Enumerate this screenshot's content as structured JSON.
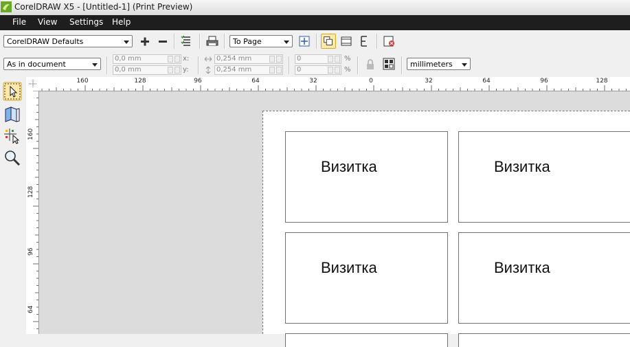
{
  "window": {
    "title": "CorelDRAW X5 - [Untitled-1] (Print Preview)"
  },
  "menu": [
    {
      "label": "File"
    },
    {
      "label": "View"
    },
    {
      "label": "Settings"
    },
    {
      "label": "Help"
    }
  ],
  "toolbar1": {
    "preset": "CorelDRAW Defaults",
    "fit": "To Page"
  },
  "toolbar2": {
    "position_mode": "As in document",
    "x_value": "0,0 mm",
    "y_value": "0,0 mm",
    "x_label": "x:",
    "y_label": "y:",
    "width_value": "0,254 mm",
    "height_value": "0,254 mm",
    "scale_w": "0",
    "scale_h": "0",
    "percent": "%",
    "units": "millimeters"
  },
  "ruler_h": {
    "ticks": [
      "160",
      "128",
      "96",
      "64",
      "32",
      "0",
      "32",
      "64",
      "96",
      "128"
    ]
  },
  "ruler_v": {
    "ticks": [
      "160",
      "128",
      "96",
      "64"
    ]
  },
  "cards": [
    {
      "label": "Визитка"
    },
    {
      "label": "Визитка"
    },
    {
      "label": "Визитка"
    },
    {
      "label": "Визитка"
    }
  ],
  "colors": {
    "menubar": "#1e1e1e",
    "canvas": "#dcdcdc",
    "page": "#ffffff",
    "logo": "#8bc34a"
  }
}
